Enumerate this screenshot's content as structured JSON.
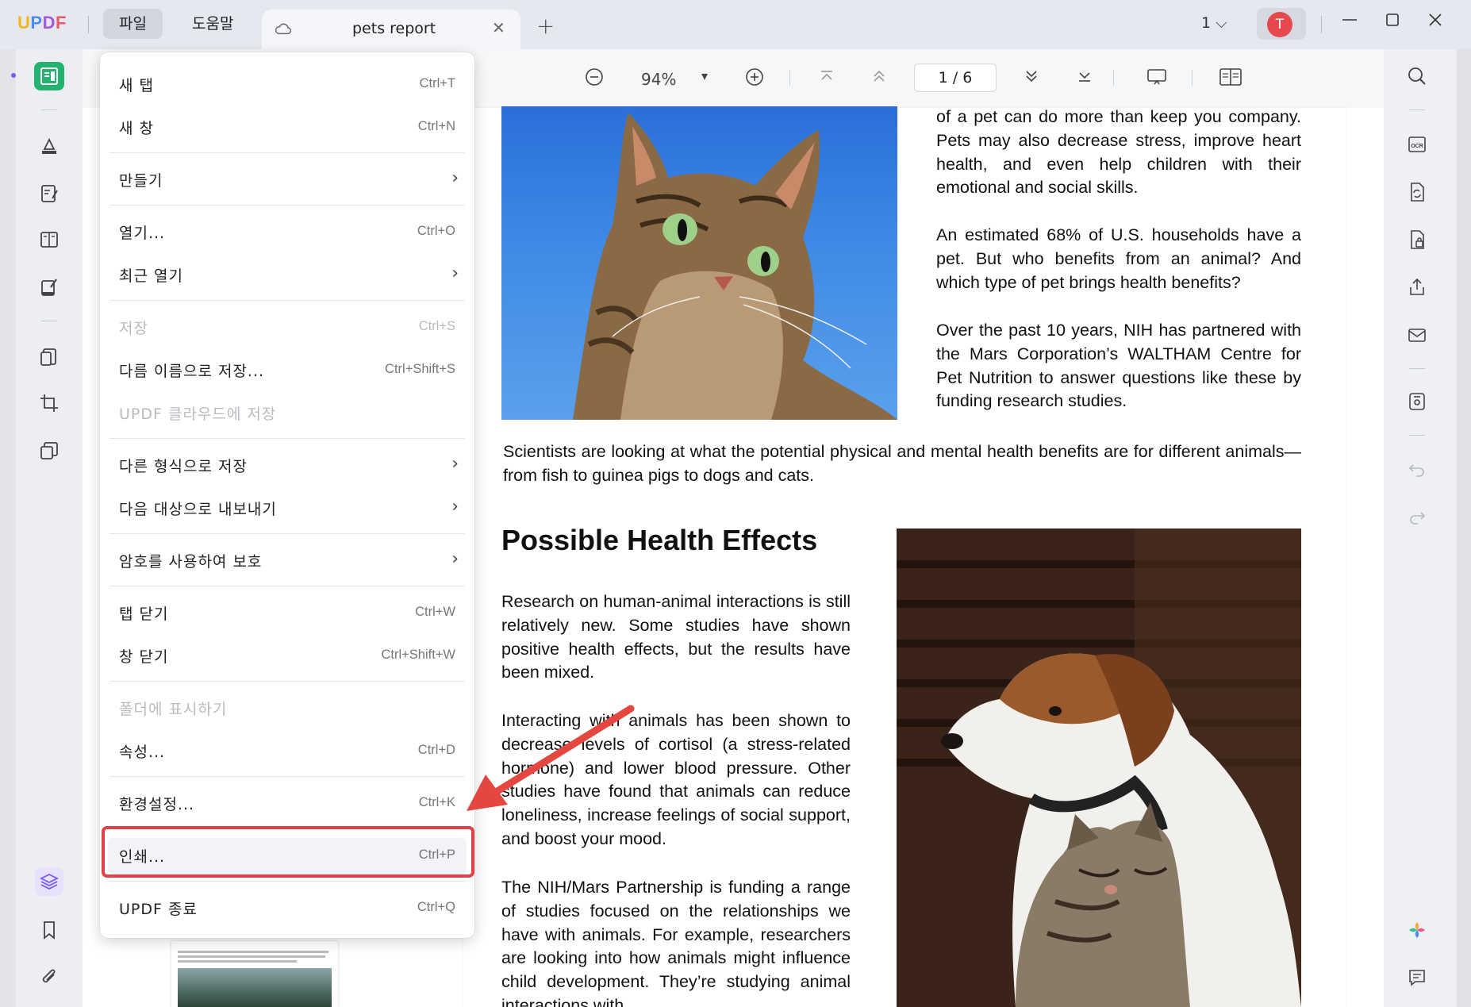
{
  "app": {
    "logo_text": "UPDF",
    "menus": [
      "파일",
      "도움말"
    ],
    "tab_title": "pets report",
    "tab_close": "✕",
    "tab_add": "+",
    "page_selector": "1 ⌵",
    "avatar_letter": "T"
  },
  "toolbar": {
    "zoom": "94%",
    "zoom_dropdown": "▾",
    "page_indicator": "1 / 6"
  },
  "menu": {
    "items": [
      {
        "label": "새 탭",
        "shortcut": "Ctrl+T"
      },
      {
        "label": "새 창",
        "shortcut": "Ctrl+N"
      },
      {
        "label": "만들기",
        "arrow": "›"
      },
      {
        "label": "열기...",
        "shortcut": "Ctrl+O"
      },
      {
        "label": "최근 열기",
        "arrow": "›"
      },
      {
        "label": "저장",
        "shortcut": "Ctrl+S",
        "disabled": true
      },
      {
        "label": "다름 이름으로 저장...",
        "shortcut": "Ctrl+Shift+S"
      },
      {
        "label": "UPDF 클라우드에 저장",
        "disabled": true
      },
      {
        "label": "다른 형식으로 저장",
        "arrow": "›"
      },
      {
        "label": "다음 대상으로 내보내기",
        "arrow": "›"
      },
      {
        "label": "암호를 사용하여 보호",
        "arrow": "›"
      },
      {
        "label": "탭 닫기",
        "shortcut": "Ctrl+W"
      },
      {
        "label": "창 닫기",
        "shortcut": "Ctrl+Shift+W"
      },
      {
        "label": "폴더에 표시하기",
        "disabled": true
      },
      {
        "label": "속성...",
        "shortcut": "Ctrl+D"
      },
      {
        "label": "환경설정...",
        "shortcut": "Ctrl+K"
      },
      {
        "label": "인쇄...",
        "shortcut": "Ctrl+P",
        "highlighted": true
      },
      {
        "label": "UPDF 종료",
        "shortcut": "Ctrl+Q"
      }
    ]
  },
  "document": {
    "para_top_1": "of a pet can do more than keep you company. Pets may also decrease stress, improve heart health, and even help children with their emotional and social skills.",
    "para_top_2": "An estimated 68% of U.S. households have a pet. But who benefits from an animal? And which type of pet brings health benefits?",
    "para_top_3": "Over the past 10 years, NIH has partnered with the Mars Corporation’s WALTHAM Centre for Pet Nutrition to answer questions like these by funding research studies.",
    "para_full": "Scientists are looking at what the potential physical and mental health benefits are for different animals—from fish to guinea pigs to dogs and cats.",
    "heading": "Possible Health Effects",
    "para_col_1": "Research on human-animal interactions is still relatively new. Some studies have shown positive health effects, but the results have been mixed.",
    "para_col_2": "Interacting with animals has been shown to decrease levels of cortisol (a stress-related hormone) and lower blood pressure. Other studies have found that animals can reduce loneliness, increase feelings of social support, and boost your mood.",
    "para_col_3": "The NIH/Mars Partnership is funding a range of studies focused on the relationships we have with animals. For example, researchers are looking into how animals might influence child development. They’re studying animal interactions with"
  },
  "colors": {
    "accent_green": "#24b36f",
    "highlight_red": "#e0424a",
    "avatar_red": "#e5484d",
    "layer_purple": "#7a5af0"
  },
  "icons": {
    "left": [
      "reader-icon",
      "highlighter-icon",
      "edit-text-icon",
      "organize-pages-icon",
      "sign-icon",
      "page-extract-icon",
      "crop-icon",
      "compare-icon",
      "layers-icon",
      "bookmark-icon",
      "attachment-icon"
    ],
    "right": [
      "search-icon",
      "ocr-icon",
      "convert-icon",
      "protect-icon",
      "share-icon",
      "email-icon",
      "save-icon",
      "undo-icon",
      "redo-icon",
      "ai-assistant-icon",
      "comment-icon"
    ]
  }
}
